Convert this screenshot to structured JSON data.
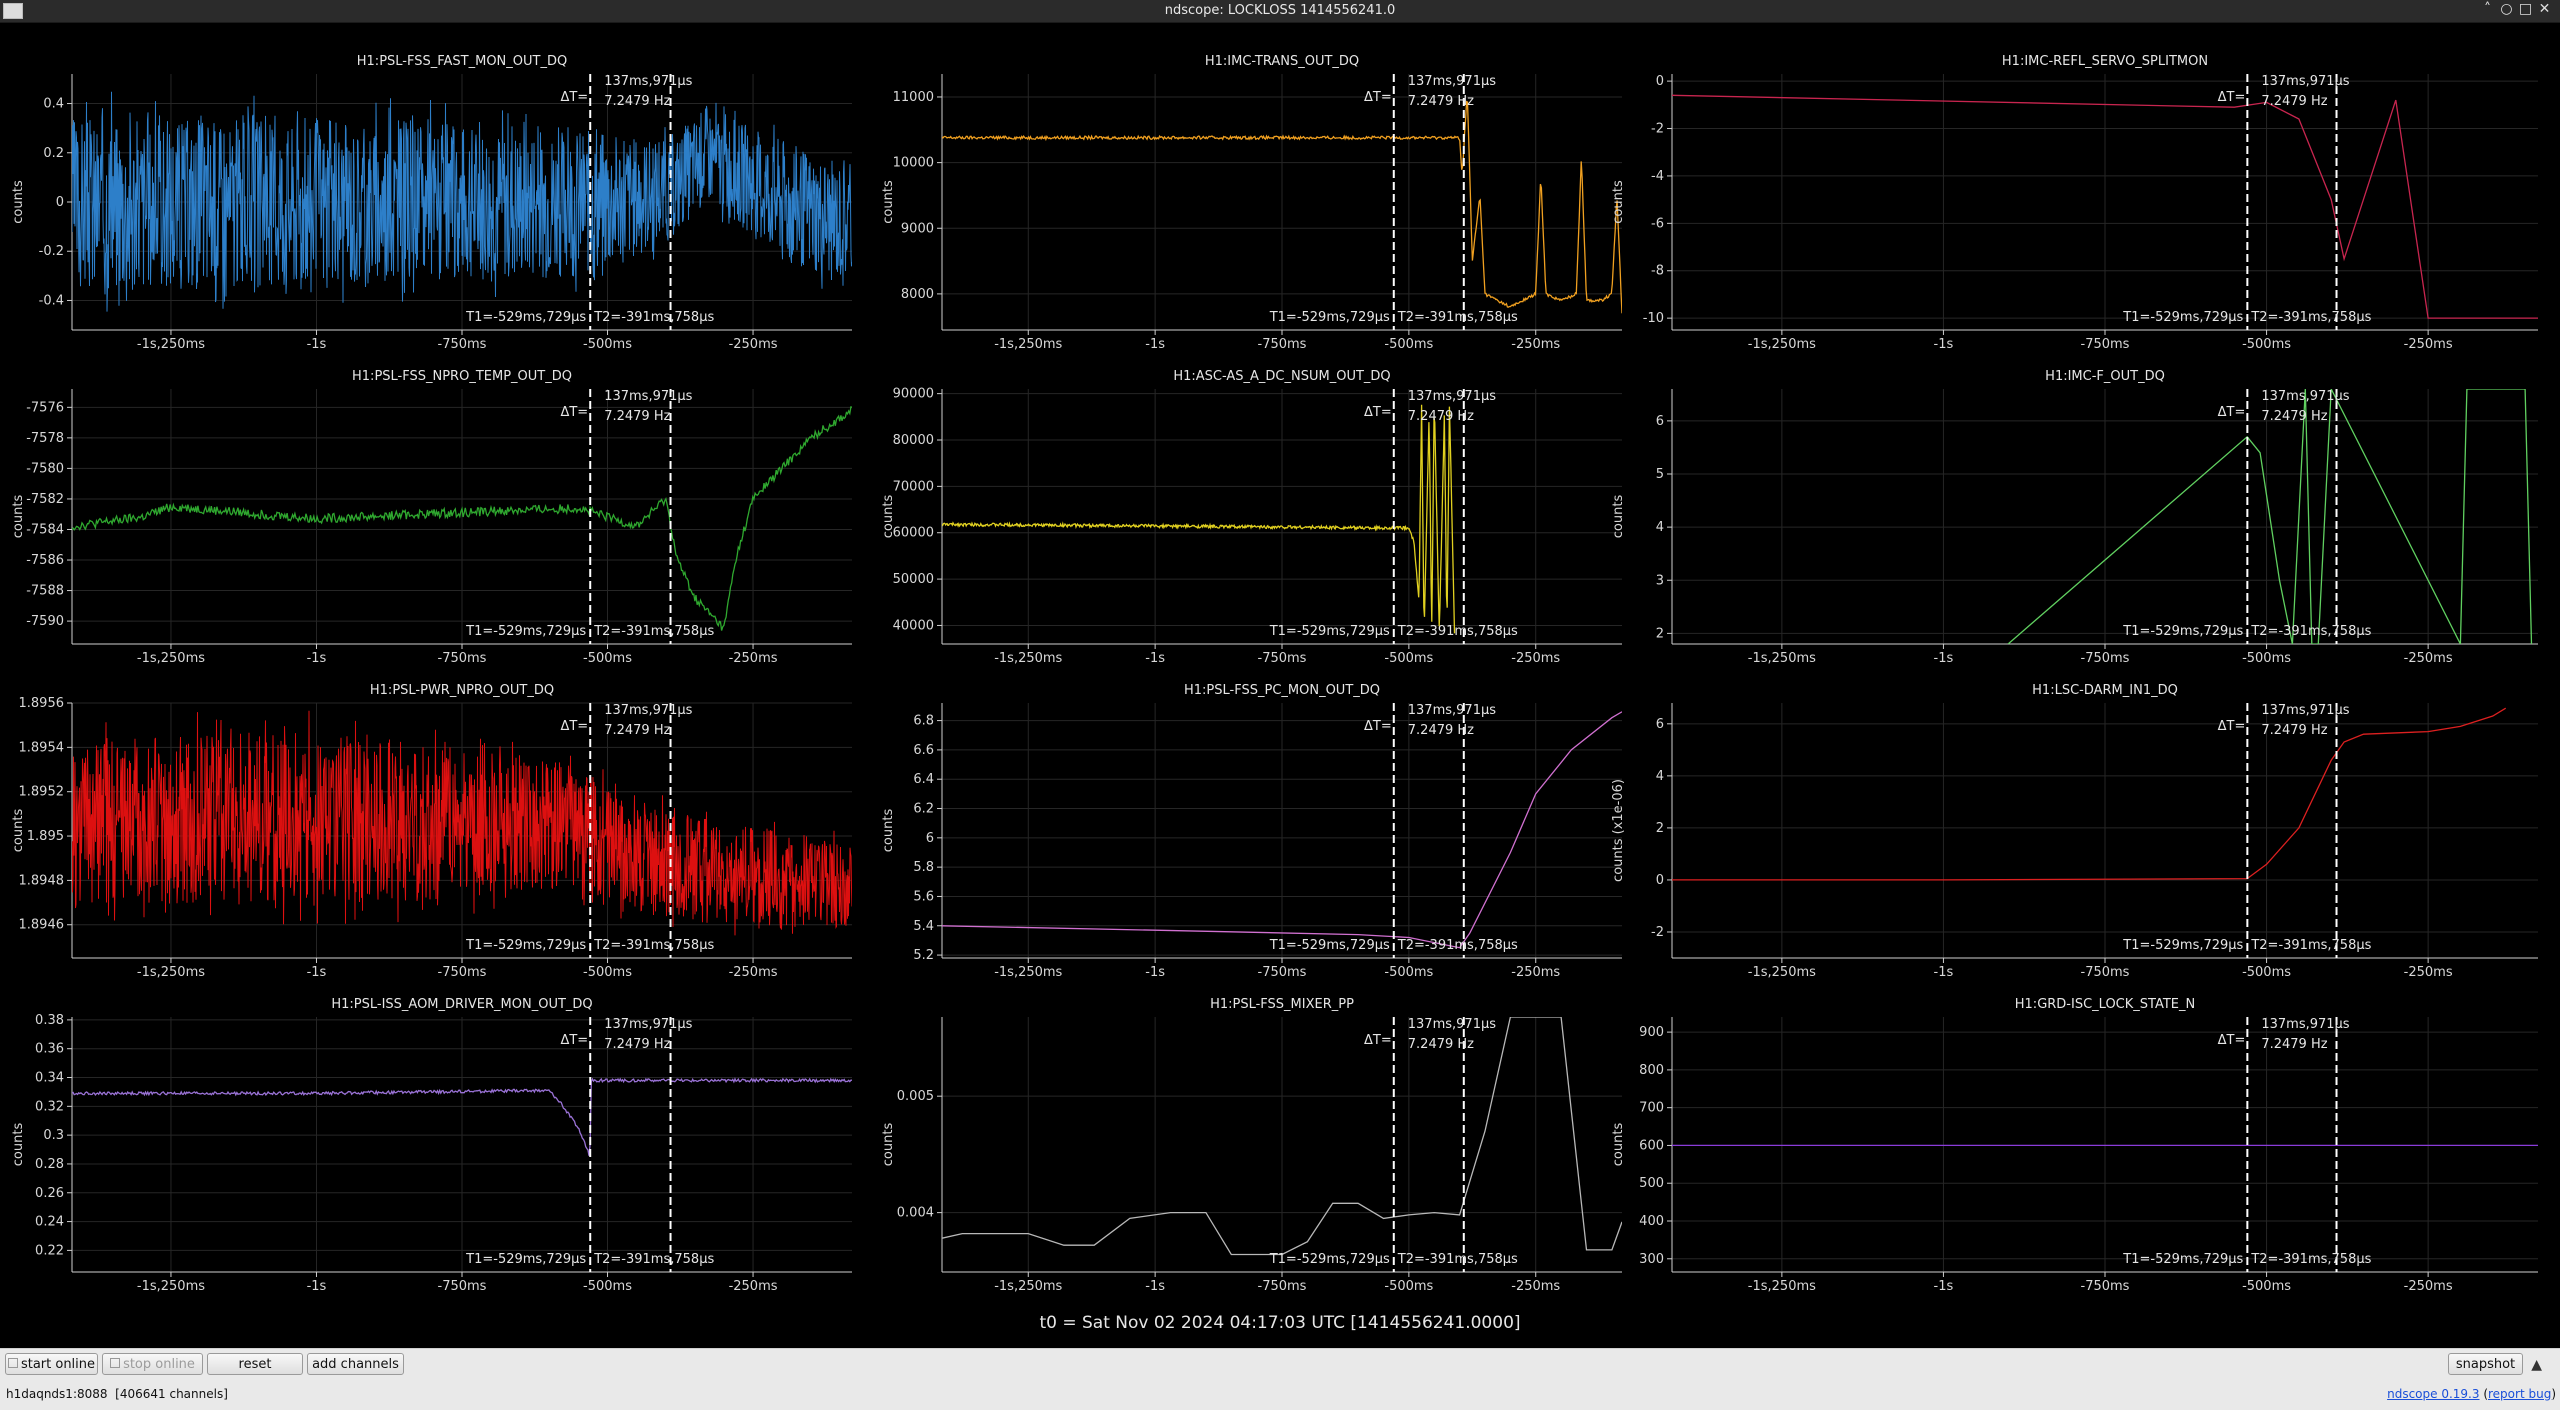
{
  "window": {
    "title": "ndscope: LOCKLOSS 1414556241.0",
    "controls": [
      "˄",
      "○",
      "□",
      "✕"
    ]
  },
  "cursors": {
    "delta_label": "ΔT=",
    "delta_value": "137ms,971µs",
    "freq": "7.2479 Hz",
    "t1": "T1=-529ms,729µs",
    "t2": "T2=-391ms,758µs",
    "t1_time": -0.529729,
    "t2_time": -0.391758
  },
  "x_axis": {
    "range": [
      -1.42,
      -0.08
    ],
    "ticks": [
      -1.25,
      -1.0,
      -0.75,
      -0.5,
      -0.25
    ],
    "tick_labels": [
      "-1s,250ms",
      "-1s",
      "-750ms",
      "-500ms",
      "-250ms"
    ]
  },
  "chart_data": [
    {
      "type": "line",
      "title": "H1:PSL-FSS_FAST_MON_OUT_DQ",
      "ylabel": "counts",
      "color": "#2d7fc9",
      "ylim": [
        -0.52,
        0.52
      ],
      "yticks": [
        -0.4,
        -0.2,
        0,
        0.2,
        0.4
      ],
      "yticklabels": [
        "-0.4",
        "-0.2",
        "0",
        "0.2",
        "0.4"
      ],
      "x": [
        -1.4,
        -1.1,
        -0.8,
        -0.55,
        -0.5,
        -0.39,
        -0.33,
        -0.3,
        -0.2,
        -0.1
      ],
      "upper": [
        0.45,
        0.44,
        0.42,
        0.38,
        0.36,
        0.3,
        0.45,
        0.4,
        0.32,
        0.22
      ],
      "lower": [
        -0.45,
        -0.44,
        -0.42,
        -0.38,
        -0.36,
        -0.2,
        -0.05,
        -0.1,
        -0.3,
        -0.4
      ]
    },
    {
      "type": "line",
      "title": "H1:IMC-TRANS_OUT_DQ",
      "ylabel": "counts",
      "color": "#f0a020",
      "ylim": [
        7450,
        11350
      ],
      "yticks": [
        8000,
        9000,
        10000,
        11000
      ],
      "yticklabels": [
        "8000",
        "9000",
        "10000",
        "11000"
      ],
      "x": [
        -1.42,
        -0.4,
        -0.395,
        -0.385,
        -0.375,
        -0.36,
        -0.35,
        -0.3,
        -0.25,
        -0.24,
        -0.23,
        -0.2,
        -0.17,
        -0.16,
        -0.15,
        -0.12,
        -0.1,
        -0.09,
        -0.08
      ],
      "y": [
        10380,
        10380,
        9800,
        11100,
        8500,
        9500,
        8000,
        7800,
        8000,
        9800,
        8000,
        7900,
        8000,
        10100,
        7900,
        7900,
        8000,
        9500,
        7700
      ]
    },
    {
      "type": "line",
      "title": "H1:IMC-REFL_SERVO_SPLITMON",
      "ylabel": "counts",
      "color": "#c8254f",
      "ylim": [
        -10.5,
        0.3
      ],
      "yticks": [
        -10,
        -8,
        -6,
        -4,
        -2,
        0
      ],
      "yticklabels": [
        "-10",
        "-8",
        "-6",
        "-4",
        "-2",
        "0"
      ],
      "x": [
        -1.42,
        -0.55,
        -0.5,
        -0.45,
        -0.4,
        -0.38,
        -0.3,
        -0.25,
        -0.08
      ],
      "y": [
        -0.6,
        -1.1,
        -0.9,
        -1.6,
        -5.0,
        -7.5,
        -0.8,
        -10.0,
        -10.0
      ]
    },
    {
      "type": "line",
      "title": "H1:PSL-FSS_NPRO_TEMP_OUT_DQ",
      "ylabel": "counts",
      "color": "#2fa82f",
      "ylim": [
        -7591.5,
        -7574.8
      ],
      "yticks": [
        -7590,
        -7588,
        -7586,
        -7584,
        -7582,
        -7580,
        -7578,
        -7576
      ],
      "yticklabels": [
        "-7590",
        "-7588",
        "-7586",
        "-7584",
        "-7582",
        "-7580",
        "-7578",
        "-7576"
      ],
      "x": [
        -1.42,
        -1.3,
        -1.25,
        -1.0,
        -0.7,
        -0.55,
        -0.45,
        -0.4,
        -0.38,
        -0.35,
        -0.3,
        -0.28,
        -0.25,
        -0.15,
        -0.08
      ],
      "y": [
        -7583.8,
        -7583.2,
        -7582.5,
        -7583.3,
        -7582.8,
        -7582.6,
        -7583.8,
        -7582.0,
        -7586.0,
        -7588.5,
        -7590.5,
        -7586.0,
        -7582.0,
        -7578.0,
        -7576.2
      ]
    },
    {
      "type": "line",
      "title": "H1:ASC-AS_A_DC_NSUM_OUT_DQ",
      "ylabel": "counts",
      "color": "#e0d020",
      "ylim": [
        36000,
        91000
      ],
      "yticks": [
        40000,
        50000,
        60000,
        70000,
        80000,
        90000
      ],
      "yticklabels": [
        "40000",
        "50000",
        "60000",
        "70000",
        "80000",
        "90000"
      ],
      "x": [
        -1.42,
        -0.5,
        -0.49,
        -0.48,
        -0.475,
        -0.47,
        -0.46,
        -0.455,
        -0.45,
        -0.44,
        -0.43,
        -0.425,
        -0.42,
        -0.41
      ],
      "y": [
        61800,
        61000,
        58000,
        45000,
        88000,
        38000,
        86000,
        38000,
        89000,
        38000,
        86000,
        38000,
        88000,
        38000
      ]
    },
    {
      "type": "line",
      "title": "H1:IMC-F_OUT_DQ",
      "ylabel": "counts",
      "color": "#60d060",
      "ylim": [
        1.8,
        6.6
      ],
      "yticks": [
        2,
        3,
        4,
        5,
        6
      ],
      "yticklabels": [
        "2",
        "3",
        "4",
        "5",
        "6"
      ],
      "x": [
        -0.9,
        -0.53,
        -0.51,
        -0.48,
        -0.46,
        -0.44,
        -0.43,
        -0.42,
        -0.4,
        -0.2,
        -0.19,
        -0.1,
        -0.09
      ],
      "y": [
        1.8,
        5.7,
        5.4,
        3.0,
        1.8,
        6.6,
        1.8,
        1.8,
        6.6,
        1.8,
        6.6,
        6.6,
        1.8
      ]
    },
    {
      "type": "line",
      "title": "H1:PSL-PWR_NPRO_OUT_DQ",
      "ylabel": "counts",
      "color": "#dd1010",
      "ylim": [
        1.89445,
        1.8956
      ],
      "yticks": [
        1.8946,
        1.8948,
        1.895,
        1.8952,
        1.8954,
        1.8956
      ],
      "yticklabels": [
        "1.8946",
        "1.8948",
        "1.895",
        "1.8952",
        "1.8954",
        "1.8956"
      ],
      "x": [
        -1.42,
        -1.1,
        -0.8,
        -0.55,
        -0.5,
        -0.39,
        -0.3,
        -0.2,
        -0.08
      ],
      "upper": [
        1.8955,
        1.8956,
        1.8955,
        1.8954,
        1.8953,
        1.8952,
        1.8951,
        1.8951,
        1.895
      ],
      "lower": [
        1.8946,
        1.8946,
        1.8946,
        1.8947,
        1.8946,
        1.89455,
        1.89455,
        1.8945,
        1.89455
      ]
    },
    {
      "type": "line",
      "title": "H1:PSL-FSS_PC_MON_OUT_DQ",
      "ylabel": "counts",
      "color": "#d070d0",
      "ylim": [
        5.18,
        6.92
      ],
      "yticks": [
        5.2,
        5.4,
        5.6,
        5.8,
        6.0,
        6.2,
        6.4,
        6.6,
        6.8
      ],
      "yticklabels": [
        "5.2",
        "5.4",
        "5.6",
        "5.8",
        "6",
        "6.2",
        "6.4",
        "6.6",
        "6.8"
      ],
      "x": [
        -1.42,
        -1.0,
        -0.6,
        -0.5,
        -0.4,
        -0.38,
        -0.3,
        -0.25,
        -0.18,
        -0.1,
        -0.08
      ],
      "y": [
        5.4,
        5.37,
        5.34,
        5.32,
        5.25,
        5.35,
        5.9,
        6.3,
        6.6,
        6.82,
        6.86
      ]
    },
    {
      "type": "line",
      "title": "H1:LSC-DARM_IN1_DQ",
      "ylabel": "counts (x1e-06)",
      "color": "#dd2020",
      "ylim": [
        -3.0,
        6.8
      ],
      "yticks": [
        -2,
        0,
        2,
        4,
        6
      ],
      "yticklabels": [
        "-2",
        "0",
        "2",
        "4",
        "6"
      ],
      "x": [
        -1.42,
        -1.0,
        -0.53,
        -0.5,
        -0.45,
        -0.4,
        -0.38,
        -0.35,
        -0.25,
        -0.2,
        -0.15,
        -0.13
      ],
      "y": [
        0.0,
        0.0,
        0.05,
        0.6,
        2.0,
        4.6,
        5.3,
        5.6,
        5.7,
        5.9,
        6.3,
        6.6
      ]
    },
    {
      "type": "line",
      "title": "H1:PSL-ISS_AOM_DRIVER_MON_OUT_DQ",
      "ylabel": "counts",
      "color": "#9a72d6",
      "ylim": [
        0.205,
        0.382
      ],
      "yticks": [
        0.22,
        0.24,
        0.26,
        0.28,
        0.3,
        0.32,
        0.34,
        0.36,
        0.38
      ],
      "yticklabels": [
        "0.22",
        "0.24",
        "0.26",
        "0.28",
        "0.3",
        "0.32",
        "0.34",
        "0.36",
        "0.38"
      ],
      "x": [
        -1.42,
        -1.0,
        -0.6,
        -0.58,
        -0.55,
        -0.53,
        -0.529,
        -0.3,
        -0.08
      ],
      "y": [
        0.329,
        0.329,
        0.331,
        0.322,
        0.305,
        0.285,
        0.338,
        0.338,
        0.338
      ]
    },
    {
      "type": "line",
      "title": "H1:PSL-FSS_MIXER_PP",
      "ylabel": "counts",
      "color": "#b8b8b8",
      "ylim": [
        0.00349,
        0.00568
      ],
      "yticks": [
        0.004,
        0.005
      ],
      "yticklabels": [
        "0.004",
        "0.005"
      ],
      "x": [
        -1.42,
        -1.38,
        -1.25,
        -1.18,
        -1.12,
        -1.05,
        -0.97,
        -0.9,
        -0.85,
        -0.8,
        -0.75,
        -0.7,
        -0.65,
        -0.6,
        -0.55,
        -0.5,
        -0.45,
        -0.4,
        -0.35,
        -0.3,
        -0.25,
        -0.2,
        -0.15,
        -0.1,
        -0.08
      ],
      "y": [
        0.00378,
        0.00382,
        0.00382,
        0.00372,
        0.00372,
        0.00395,
        0.004,
        0.004,
        0.00364,
        0.00364,
        0.00364,
        0.00375,
        0.00408,
        0.00408,
        0.00395,
        0.00398,
        0.004,
        0.00398,
        0.0047,
        0.00568,
        0.00568,
        0.00568,
        0.00368,
        0.00368,
        0.00392
      ]
    },
    {
      "type": "line",
      "title": "H1:GRD-ISC_LOCK_STATE_N",
      "ylabel": "counts",
      "color": "#8a3cd8",
      "ylim": [
        265,
        940
      ],
      "yticks": [
        300,
        400,
        500,
        600,
        700,
        800,
        900
      ],
      "yticklabels": [
        "300",
        "400",
        "500",
        "600",
        "700",
        "800",
        "900"
      ],
      "x": [
        -1.42,
        -0.08
      ],
      "y": [
        600,
        600
      ]
    }
  ],
  "footer": {
    "t0": "t0 = Sat Nov 02 2024 04:17:03 UTC [1414556241.0000]"
  },
  "toolbar": {
    "start_online": "start online",
    "stop_online": "stop online",
    "reset": "reset",
    "add_channels": "add channels",
    "snapshot": "snapshot"
  },
  "status": {
    "server": "h1daqnds1:8088",
    "channels": "[406641 channels]",
    "version": "ndscope 0.19.3",
    "report_bug": "report bug"
  }
}
